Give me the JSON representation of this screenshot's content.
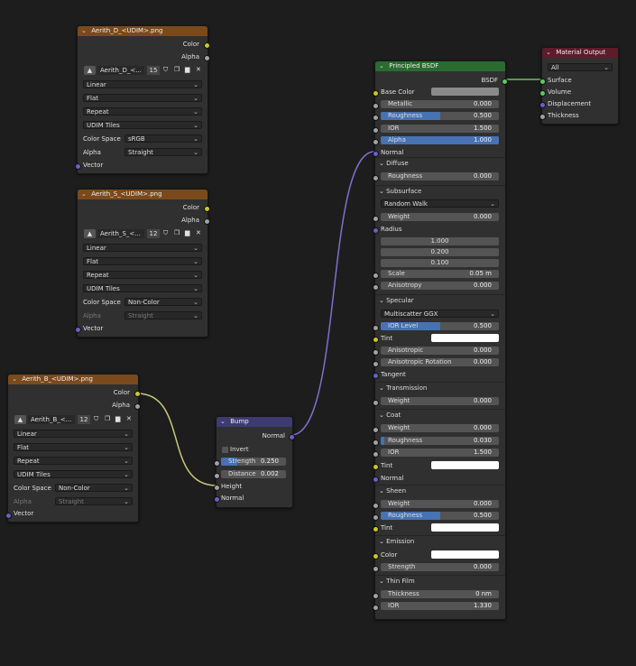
{
  "tex_d": {
    "title": "Aerith_D_<UDIM>.png",
    "out_color": "Color",
    "out_alpha": "Alpha",
    "image_name": "Aerith_D_<...",
    "users": "15",
    "interp": "Linear",
    "proj": "Flat",
    "ext": "Repeat",
    "source": "UDIM Tiles",
    "cs_label": "Color Space",
    "cs_value": "sRGB",
    "alpha_label": "Alpha",
    "alpha_value": "Straight",
    "vector": "Vector"
  },
  "tex_s": {
    "title": "Aerith_S_<UDIM>.png",
    "out_color": "Color",
    "out_alpha": "Alpha",
    "image_name": "Aerith_S_<...",
    "users": "12",
    "interp": "Linear",
    "proj": "Flat",
    "ext": "Repeat",
    "source": "UDIM Tiles",
    "cs_label": "Color Space",
    "cs_value": "Non-Color",
    "alpha_label": "Alpha",
    "alpha_value": "Straight",
    "vector": "Vector"
  },
  "tex_b": {
    "title": "Aerith_B_<UDIM>.png",
    "out_color": "Color",
    "out_alpha": "Alpha",
    "image_name": "Aerith_B_<...",
    "users": "12",
    "interp": "Linear",
    "proj": "Flat",
    "ext": "Repeat",
    "source": "UDIM Tiles",
    "cs_label": "Color Space",
    "cs_value": "Non-Color",
    "alpha_label": "Alpha",
    "alpha_value": "Straight",
    "vector": "Vector"
  },
  "bump": {
    "title": "Bump",
    "out_normal": "Normal",
    "invert": "Invert",
    "strength_label": "Strength",
    "strength_value": "0.250",
    "distance_label": "Distance",
    "distance_value": "0.002",
    "height": "Height",
    "normal": "Normal"
  },
  "bsdf": {
    "title": "Principled BSDF",
    "out": "BSDF",
    "base_color": "Base Color",
    "metallic": "Metallic",
    "metallic_v": "0.000",
    "roughness": "Roughness",
    "roughness_v": "0.500",
    "ior": "IOR",
    "ior_v": "1.500",
    "alpha": "Alpha",
    "alpha_v": "1.000",
    "normal": "Normal",
    "diffuse": "Diffuse",
    "diff_rough": "Roughness",
    "diff_rough_v": "0.000",
    "subsurface": "Subsurface",
    "ss_method": "Random Walk",
    "ss_weight": "Weight",
    "ss_weight_v": "0.000",
    "radius": "Radius",
    "radius_v": [
      "1.000",
      "0.200",
      "0.100"
    ],
    "scale": "Scale",
    "scale_v": "0.05 m",
    "ss_aniso": "Anisotropy",
    "ss_aniso_v": "0.000",
    "specular": "Specular",
    "spec_method": "Multiscatter GGX",
    "ior_level": "IOR Level",
    "ior_level_v": "0.500",
    "tint": "Tint",
    "anisotropic": "Anisotropic",
    "anisotropic_v": "0.000",
    "aniso_rot": "Anisotropic Rotation",
    "aniso_rot_v": "0.000",
    "tangent": "Tangent",
    "transmission": "Transmission",
    "trans_weight": "Weight",
    "trans_weight_v": "0.000",
    "coat": "Coat",
    "coat_weight": "Weight",
    "coat_weight_v": "0.000",
    "coat_rough": "Roughness",
    "coat_rough_v": "0.030",
    "coat_ior": "IOR",
    "coat_ior_v": "1.500",
    "coat_tint": "Tint",
    "coat_normal": "Normal",
    "sheen": "Sheen",
    "sheen_weight": "Weight",
    "sheen_weight_v": "0.000",
    "sheen_rough": "Roughness",
    "sheen_rough_v": "0.500",
    "sheen_tint": "Tint",
    "emission": "Emission",
    "em_color": "Color",
    "em_strength": "Strength",
    "em_strength_v": "0.000",
    "thin_film": "Thin Film",
    "tf_thickness": "Thickness",
    "tf_thickness_v": "0 nm",
    "tf_ior": "IOR",
    "tf_ior_v": "1.330"
  },
  "matout": {
    "title": "Material Output",
    "target": "All",
    "surface": "Surface",
    "volume": "Volume",
    "displacement": "Displacement",
    "thickness": "Thickness"
  },
  "colors": {
    "texture_header": "#7a4a1c",
    "vector_header": "#3e3b70",
    "shader_header": "#2a6b2f",
    "output_header": "#5e1c2b",
    "slider_fill": "#4772b3",
    "color_socket": "#c7c729",
    "float_socket": "#a1a1a1",
    "vector_socket": "#6363c7",
    "shader_socket": "#63c763"
  }
}
